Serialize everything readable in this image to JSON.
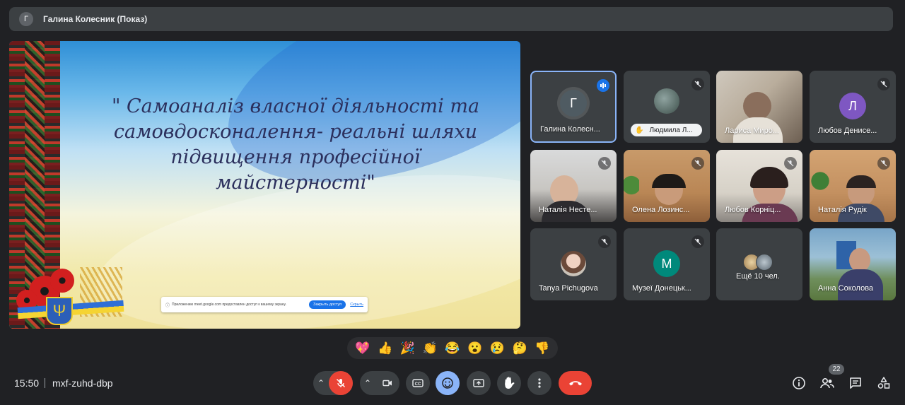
{
  "presenter_bar": {
    "avatar_letter": "Г",
    "title": "Галина Колесник (Показ)"
  },
  "slide": {
    "title_lines": [
      "\" Самоаналіз власної діяльності та",
      "самовдосконалення- реальні шляхи",
      "підвищення професійної",
      "майстерності\""
    ],
    "share_notice": {
      "text": "Приложению meet.google.com предоставлен доступ к вашему экрану.",
      "button": "Закрыть доступ",
      "link": "Скрыть"
    }
  },
  "participants": [
    {
      "name": "Галина Колесн...",
      "type": "letter",
      "letter": "Г",
      "color": "#4f5b62",
      "speaking": true
    },
    {
      "name": "Людмила Л...",
      "type": "photo",
      "hand_raised": true
    },
    {
      "name": "Лариса Миро...",
      "type": "video",
      "muted": false
    },
    {
      "name": "Любов Денисе...",
      "type": "letter",
      "letter": "Л",
      "color": "#7e57c2",
      "muted": true
    },
    {
      "name": "Наталія Несте...",
      "type": "video",
      "muted": true
    },
    {
      "name": "Олена Лозинс...",
      "type": "video",
      "muted": true
    },
    {
      "name": "Любов Корніц...",
      "type": "video",
      "muted": true
    },
    {
      "name": "Наталія Рудік",
      "type": "video",
      "muted": true
    },
    {
      "name": "Tanya Pichugova",
      "type": "photo",
      "muted": true
    },
    {
      "name": "Музеї Донецьк...",
      "type": "letter",
      "letter": "М",
      "color": "#00897b",
      "muted": true
    },
    {
      "name": "Ещё 10 чел.",
      "type": "more"
    },
    {
      "name": "Анна Соколова",
      "type": "video",
      "muted": false
    }
  ],
  "reactions": [
    "💖",
    "👍",
    "🎉",
    "👏",
    "😂",
    "😮",
    "😢",
    "🤔",
    "👎"
  ],
  "bottom_bar": {
    "time": "15:50",
    "meeting_code": "mxf-zuhd-dbp",
    "people_count": "22"
  },
  "colors": {
    "background": "#202124",
    "surface": "#3c4043",
    "accent": "#8ab4f8",
    "danger": "#ea4335",
    "speaking": "#1a73e8"
  }
}
